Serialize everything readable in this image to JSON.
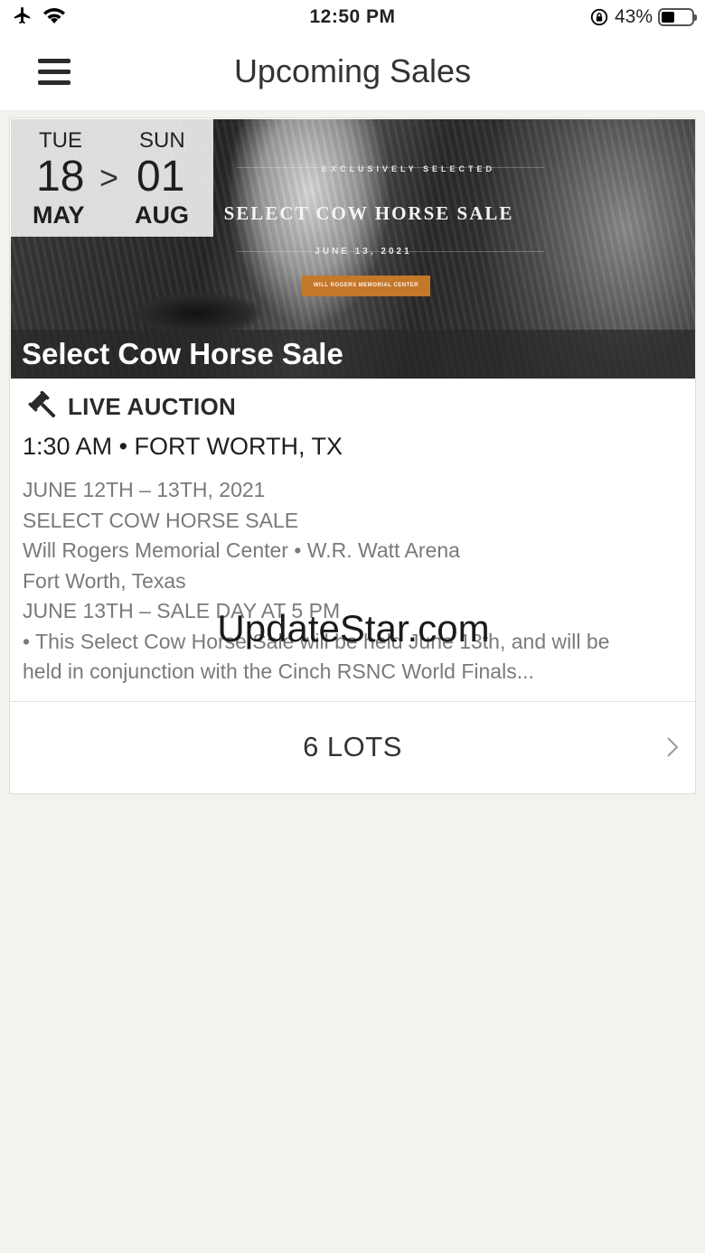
{
  "status_bar": {
    "time": "12:50 PM",
    "battery_percent": "43%",
    "battery_level": 0.43,
    "icons": [
      "airplane-icon",
      "wifi-icon",
      "orientation-lock-icon",
      "battery-icon"
    ]
  },
  "nav": {
    "title": "Upcoming Sales",
    "menu_icon": "hamburger-menu-icon"
  },
  "sale": {
    "start": {
      "dow": "TUE",
      "day": "18",
      "month": "MAY"
    },
    "end": {
      "dow": "SUN",
      "day": "01",
      "month": "AUG"
    },
    "range_separator": ">",
    "banner": {
      "eyebrow": "EXCLUSIVELY SELECTED",
      "headline": "SELECT COW HORSE SALE",
      "date": "JUNE 13, 2021",
      "venue": "WILL ROGERS MEMORIAL CENTER"
    },
    "title": "Select Cow Horse Sale",
    "auction_type": "LIVE AUCTION",
    "time_location": "1:30 AM • FORT WORTH, TX",
    "description_lines": [
      "JUNE 12TH – 13TH, 2021",
      "SELECT COW HORSE SALE",
      "Will Rogers Memorial Center • W.R. Watt Arena",
      "Fort Worth, Texas",
      "JUNE 13TH – SALE DAY AT 5 PM",
      "• This Select Cow Horse Sale will be held June 13th, and will be",
      "held in conjunction with the Cinch RSNC World Finals..."
    ],
    "lots_label": "6 LOTS"
  },
  "watermark": "UpdateStar.com",
  "colors": {
    "background": "#f3f2ef",
    "card": "#ffffff",
    "venue_badge": "#c4782a",
    "text_muted": "#7a7a7a"
  }
}
